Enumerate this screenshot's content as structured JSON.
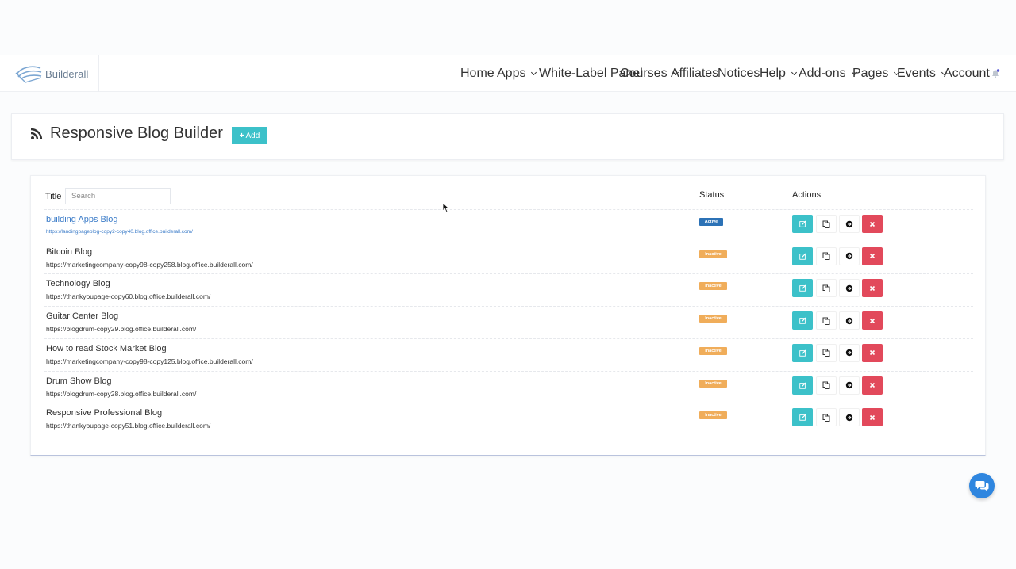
{
  "brand": {
    "name": "Builderall"
  },
  "nav": [
    {
      "label": "Home",
      "dropdown": false
    },
    {
      "label": "Apps",
      "dropdown": true
    },
    {
      "label": "White-Label Panel",
      "dropdown": false
    },
    {
      "label": "Courses",
      "dropdown": true
    },
    {
      "label": "Affiliates",
      "dropdown": false
    },
    {
      "label": "Notices",
      "dropdown": false
    },
    {
      "label": "Help",
      "dropdown": true
    },
    {
      "label": "Add-ons",
      "dropdown": true
    },
    {
      "label": "Pages",
      "dropdown": true
    },
    {
      "label": "Events",
      "dropdown": true
    },
    {
      "label": "Account",
      "dropdown": false
    }
  ],
  "header": {
    "title": "Responsive Blog Builder",
    "add_label": "Add"
  },
  "table": {
    "columns": {
      "title": "Title",
      "status": "Status",
      "actions": "Actions"
    },
    "search_placeholder": "Search",
    "rows": [
      {
        "title": "building Apps Blog",
        "url": "https://landingpageblog-copy2-copy40.blog.office.builderall.com/",
        "status": "Active"
      },
      {
        "title": "Bitcoin Blog",
        "url": "https://marketingcompany-copy98-copy258.blog.office.builderall.com/",
        "status": "Inactive"
      },
      {
        "title": "Technology Blog",
        "url": "https://thankyoupage-copy60.blog.office.builderall.com/",
        "status": "Inactive"
      },
      {
        "title": "Guitar Center Blog",
        "url": "https://blogdrum-copy29.blog.office.builderall.com/",
        "status": "Inactive"
      },
      {
        "title": "How to read Stock Market Blog",
        "url": "https://marketingcompany-copy98-copy125.blog.office.builderall.com/",
        "status": "Inactive"
      },
      {
        "title": "Drum Show Blog",
        "url": "https://blogdrum-copy28.blog.office.builderall.com/",
        "status": "Inactive"
      },
      {
        "title": "Responsive Professional Blog",
        "url": "https://thankyoupage-copy51.blog.office.builderall.com/",
        "status": "Inactive"
      }
    ]
  },
  "icons": {
    "rss": "rss-icon",
    "bell": "bell-icon",
    "edit": "edit-icon",
    "copy": "copy-icon",
    "go": "arrow-right-circle-icon",
    "delete": "close-icon",
    "chat": "chat-icon"
  },
  "colors": {
    "accent": "#3cc1c9",
    "active": "#2c72b6",
    "inactive": "#f0ad5a",
    "danger": "#e2495b",
    "link": "#3a7bc8",
    "chat": "#2f86df"
  }
}
